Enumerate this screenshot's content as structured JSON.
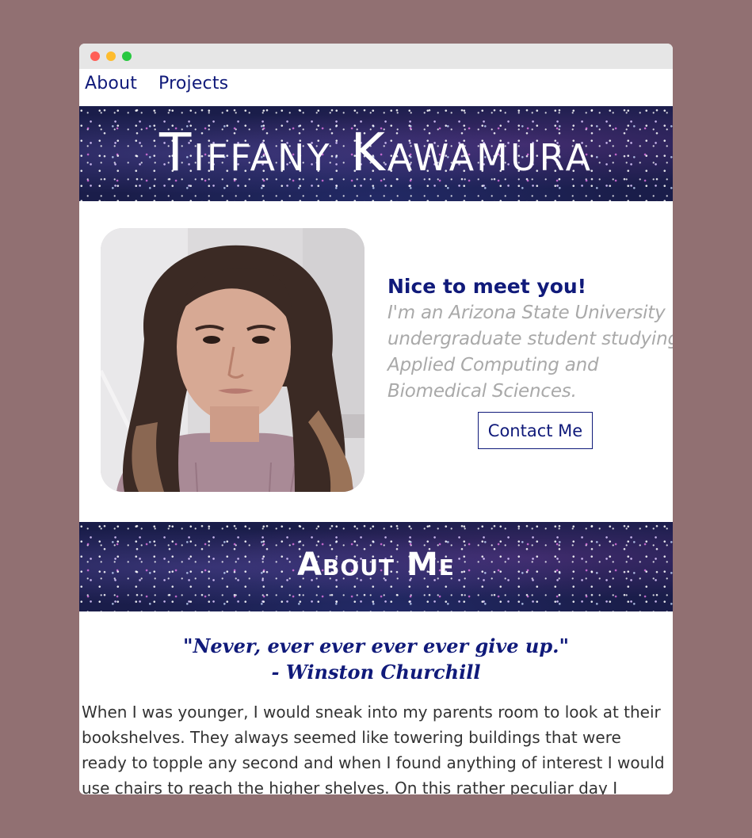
{
  "nav": {
    "items": [
      {
        "label": "About"
      },
      {
        "label": "Projects"
      }
    ]
  },
  "hero": {
    "title": "Tiffany Kawamura"
  },
  "intro": {
    "heading": "Nice to meet you!",
    "text": "I'm an Arizona State University undergraduate student studying Applied Computing and Biomedical Sciences.",
    "contact_label": "Contact Me"
  },
  "about": {
    "title": "About Me",
    "quote_line1": "\"Never, ever ever ever ever give up.\"",
    "quote_line2": "- Winston Churchill",
    "body": "When I was younger, I would sneak into my parents room to look at their bookshelves. They always seemed like towering buildings that were ready to topple any second and when I found anything of interest I would use chairs to reach the higher shelves. On this rather peculiar day I snooped"
  },
  "colors": {
    "accent": "#101a7a",
    "page_background": "#917072",
    "muted_text": "#a9a9a9"
  }
}
